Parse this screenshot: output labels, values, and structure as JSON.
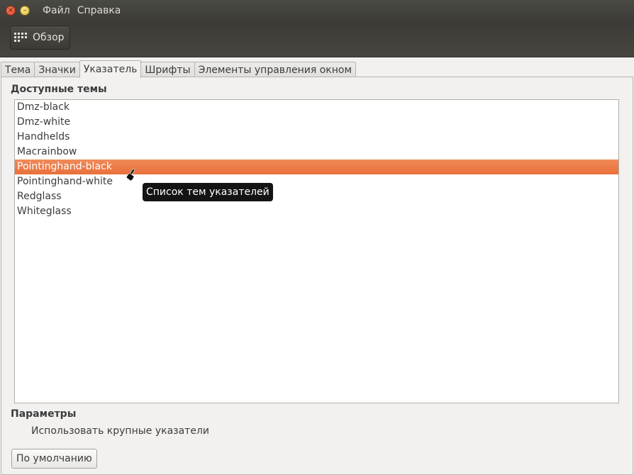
{
  "window": {
    "close_glyph": "×",
    "minimize_glyph": "–"
  },
  "menubar": {
    "items": [
      "Файл",
      "Справка"
    ]
  },
  "toolbar": {
    "overview_label": "Обзор"
  },
  "tabs": [
    {
      "label": "Тема",
      "active": false
    },
    {
      "label": "Значки",
      "active": false
    },
    {
      "label": "Указатель",
      "active": true
    },
    {
      "label": "Шрифты",
      "active": false
    },
    {
      "label": "Элементы управления окном",
      "active": false
    }
  ],
  "themes": {
    "heading": "Доступные темы",
    "items": [
      "Dmz-black",
      "Dmz-white",
      "Handhelds",
      "Macrainbow",
      "Pointinghand-black",
      "Pointinghand-white",
      "Redglass",
      "Whiteglass"
    ],
    "selected_index": 4,
    "tooltip": "Список тем указателей"
  },
  "parameters": {
    "heading": "Параметры",
    "large_cursors_label": "Использовать крупные указатели"
  },
  "buttons": {
    "default_label": "По умолчанию"
  },
  "colors": {
    "selection": "#e9703a",
    "titlebar": "#3c3b37"
  }
}
